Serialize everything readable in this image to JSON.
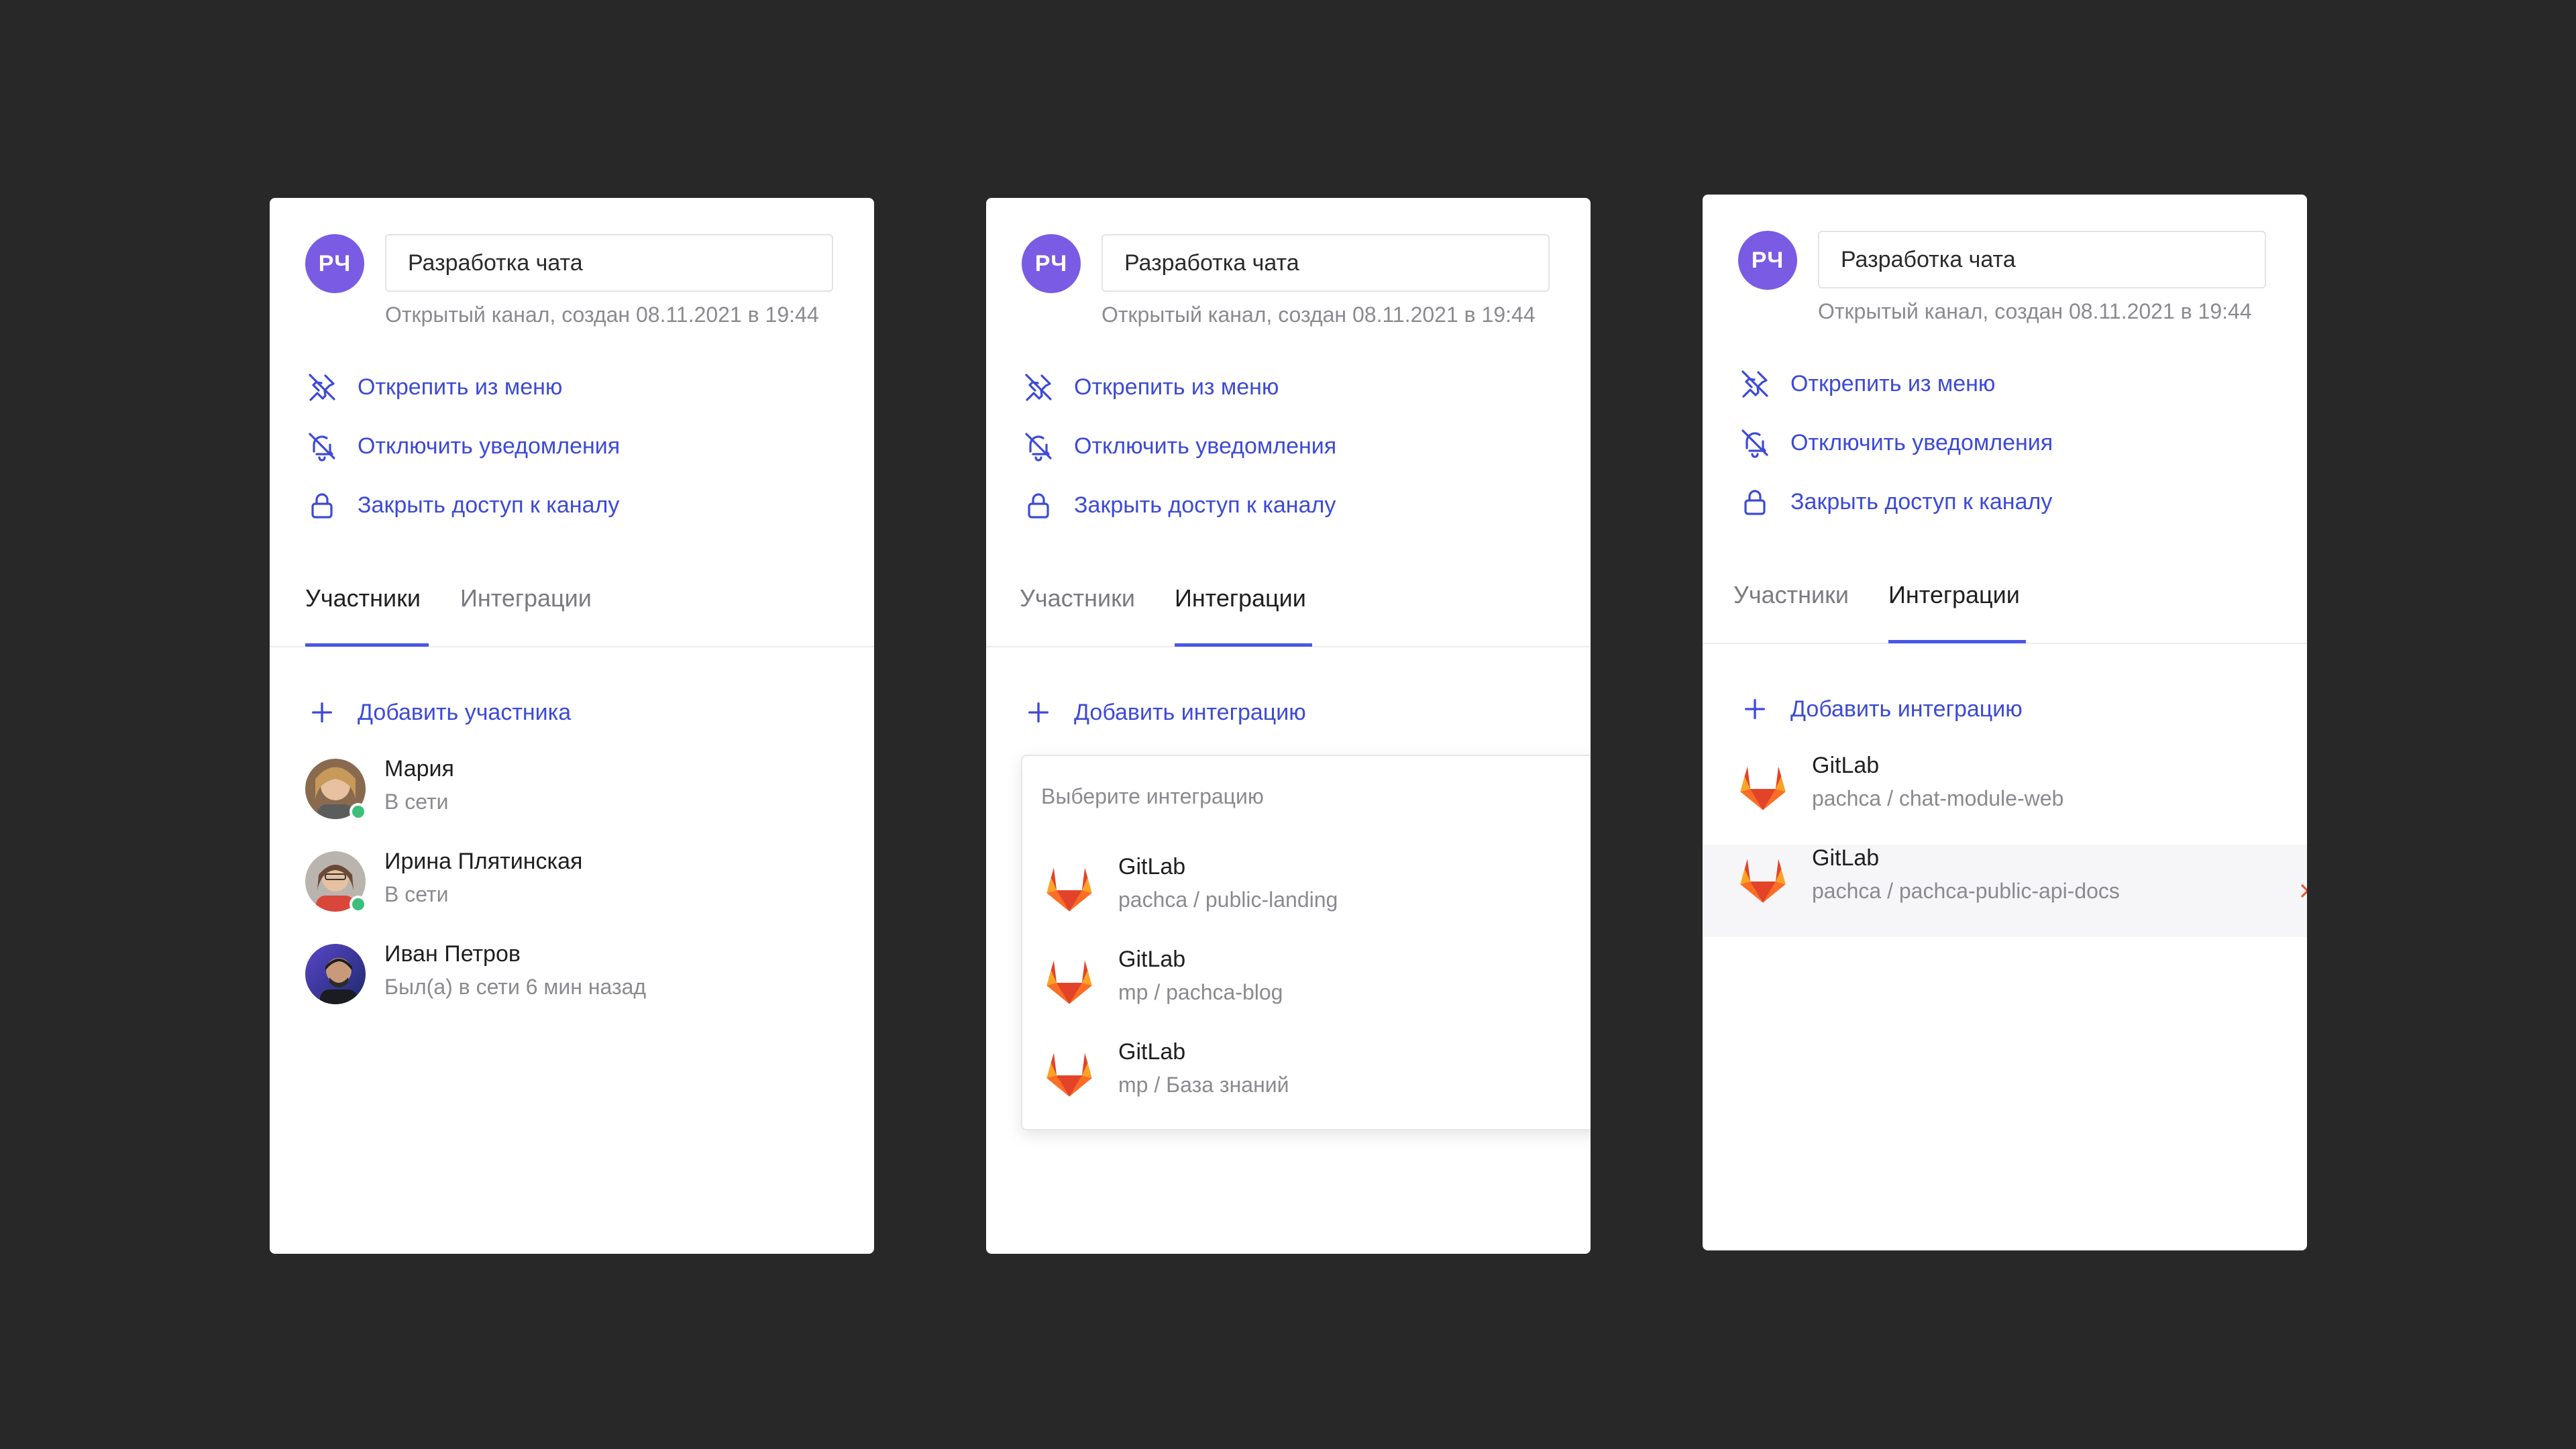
{
  "colors": {
    "background": "#282828",
    "panel": "#ffffff",
    "accent": "#3d4ad6",
    "avatar": "#7a5be3",
    "online": "#3bbf7a",
    "gitlab": "#e24329"
  },
  "channel": {
    "initials": "РЧ",
    "name": "Разработка чата",
    "meta": "Открытый канал, создан 08.11.2021 в 19:44"
  },
  "actions": {
    "unpin": "Открепить из меню",
    "mute": "Отключить уведомления",
    "lock": "Закрыть доступ к каналу"
  },
  "tabs": {
    "members": "Участники",
    "integrations": "Интеграции"
  },
  "panels": [
    {
      "active_tab": "members",
      "add_label": "Добавить участника",
      "members": [
        {
          "name": "Мария",
          "status": "В сети",
          "online": true
        },
        {
          "name": "Ирина Плятинская",
          "status": "В сети",
          "online": true
        },
        {
          "name": "Иван Петров",
          "status": "Был(а) в сети 6 мин назад",
          "online": false
        }
      ]
    },
    {
      "active_tab": "integrations",
      "add_label": "Добавить интеграцию",
      "dropdown": {
        "placeholder": "Выберите интеграцию",
        "items": [
          {
            "name": "GitLab",
            "repo": "pachca / public-landing"
          },
          {
            "name": "GitLab",
            "repo": "mp / pachca-blog"
          },
          {
            "name": "GitLab",
            "repo": "mp / База знаний"
          }
        ]
      }
    },
    {
      "active_tab": "integrations",
      "add_label": "Добавить интеграцию",
      "integrations": [
        {
          "name": "GitLab",
          "repo": "pachca / chat-module-web"
        },
        {
          "name": "GitLab",
          "repo": "pachca / pachca-public-api-docs"
        }
      ]
    }
  ]
}
